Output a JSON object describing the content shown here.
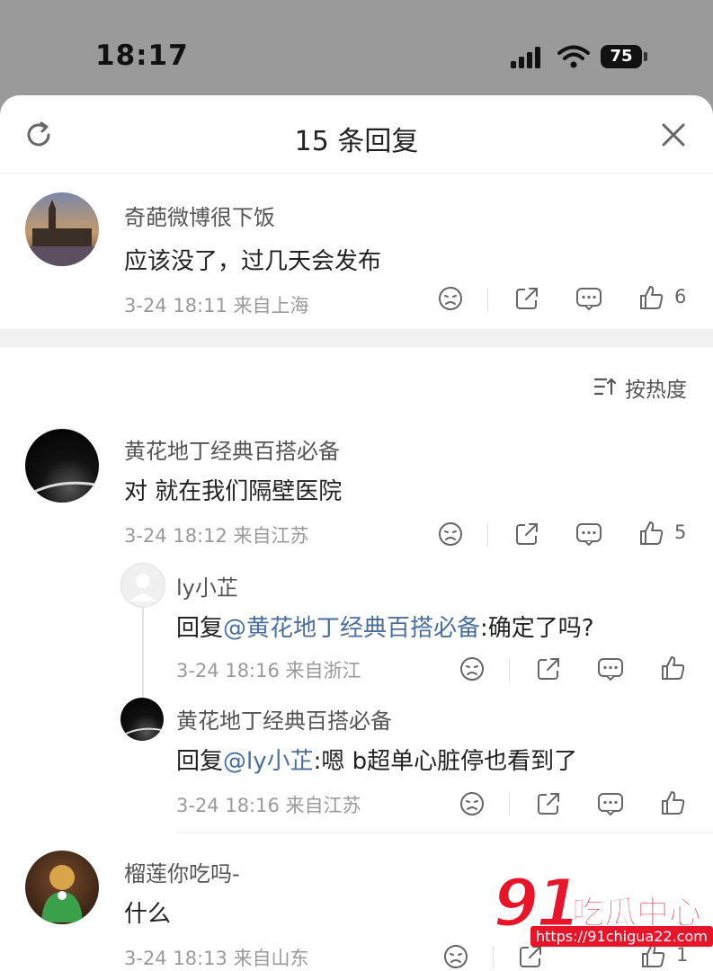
{
  "status_bar": {
    "time": "18:17",
    "battery": "75"
  },
  "sheet": {
    "title": "15 条回复"
  },
  "sort": {
    "label": "按热度"
  },
  "comments": [
    {
      "user": "奇葩微博很下饭",
      "text": "应该没了，过几天会发布",
      "time": "3-24 18:11",
      "location": "来自上海",
      "likes": "6"
    },
    {
      "user": "黄花地丁经典百搭必备",
      "text": "对 就在我们隔壁医院",
      "time": "3-24 18:12",
      "location": "来自江苏",
      "likes": "5"
    },
    {
      "user": "ly小芷",
      "reply_prefix": "回复",
      "mention": "@黄花地丁经典百搭必备",
      "text": ":确定了吗?",
      "time": "3-24 18:16",
      "location": "来自浙江",
      "likes": ""
    },
    {
      "user": "黄花地丁经典百搭必备",
      "reply_prefix": "回复",
      "mention": "@ly小芷",
      "text": ":嗯 b超单心脏停也看到了",
      "time": "3-24 18:16",
      "location": "来自江苏",
      "likes": ""
    },
    {
      "user": "榴莲你吃吗-",
      "text": "什么",
      "time": "3-24 18:13",
      "location": "来自山东",
      "likes": "1"
    }
  ],
  "watermark": {
    "big": "91",
    "cn": "吃瓜中心",
    "url": "https://91chigua22.com"
  },
  "colors": {
    "accent": "#4a6f9c",
    "watermark": "#e8142a"
  }
}
